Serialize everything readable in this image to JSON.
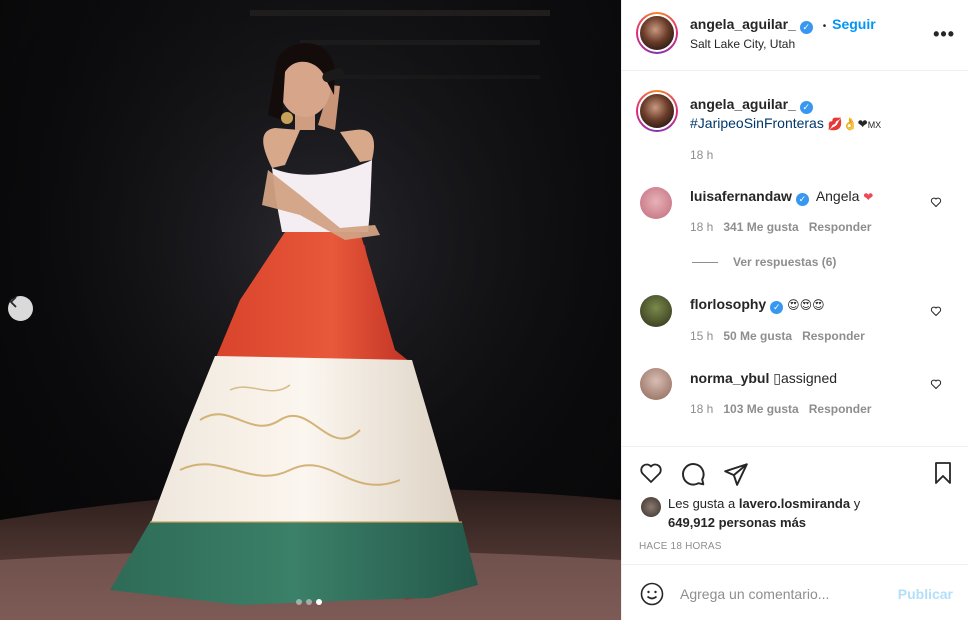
{
  "post": {
    "author": "angela_aguilar_",
    "follow_label": "Seguir",
    "separator": "•",
    "location": "Salt Lake City, Utah",
    "more_label": "•••",
    "caption_author": "angela_aguilar_",
    "caption_text": "#JaripeoSinFronteras",
    "caption_emoji": "💋👌❤",
    "caption_flag": "MX",
    "caption_time": "18 h"
  },
  "comments": [
    {
      "user": "luisafernandaw",
      "verified": true,
      "text": "Angela",
      "emoji": "❤",
      "time": "18 h",
      "likes": "341 Me gusta",
      "reply": "Responder",
      "avatar_color": "#d98a9a"
    },
    {
      "user": "florlosophy",
      "verified": true,
      "text": "",
      "emoji": "😍😍😍",
      "time": "15 h",
      "likes": "50 Me gusta",
      "reply": "Responder",
      "avatar_color": "#5a6a3a"
    },
    {
      "user": "norma_ybul",
      "verified": false,
      "text": "▯",
      "emoji": "",
      "suffix": "assigned",
      "time": "18 h",
      "likes": "103 Me gusta",
      "reply": "Responder",
      "avatar_color": "#a8857a"
    }
  ],
  "replies_toggle": "Ver respuestas (6)",
  "likes": {
    "prefix": "Les gusta a ",
    "user": "lavero.losmiranda",
    "and": " y",
    "others": "649,912 personas más"
  },
  "time_ago": "HACE 18 HORAS",
  "comment_input": {
    "placeholder": "Agrega un comentario...",
    "publish": "Publicar"
  },
  "carousel": {
    "count": 3,
    "active": 3
  },
  "colors": {
    "accent": "#0095f6",
    "verified": "#3897f0",
    "muted": "#8e8e8e",
    "heart": "#ed4956"
  },
  "icons": [
    "chevron-left-icon",
    "heart-icon",
    "comment-icon",
    "share-icon",
    "bookmark-icon",
    "emoji-icon",
    "more-icon",
    "verified-icon"
  ]
}
